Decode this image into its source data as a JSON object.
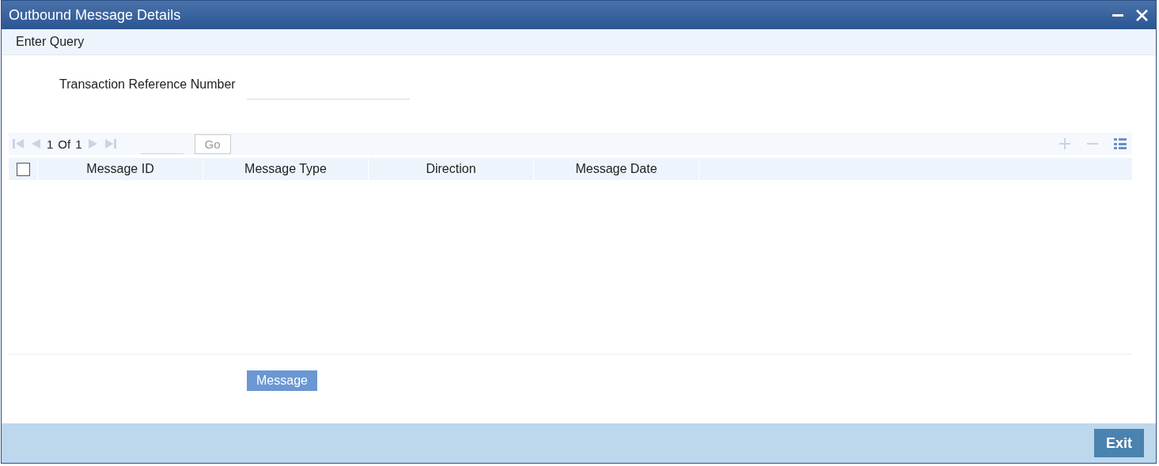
{
  "window": {
    "title": "Outbound Message Details"
  },
  "toolbar": {
    "items": [
      "Enter Query"
    ]
  },
  "form": {
    "fields": [
      {
        "label": "Transaction Reference Number"
      }
    ]
  },
  "grid": {
    "pager": {
      "current": "1",
      "of": "Of",
      "total": "1",
      "go": "Go"
    },
    "select_all": {
      "checked": false
    },
    "columns": [
      "Message ID",
      "Message Type",
      "Direction",
      "Message Date"
    ]
  },
  "actions": [
    "Message"
  ],
  "footer": {
    "buttons": [
      "Exit"
    ]
  }
}
